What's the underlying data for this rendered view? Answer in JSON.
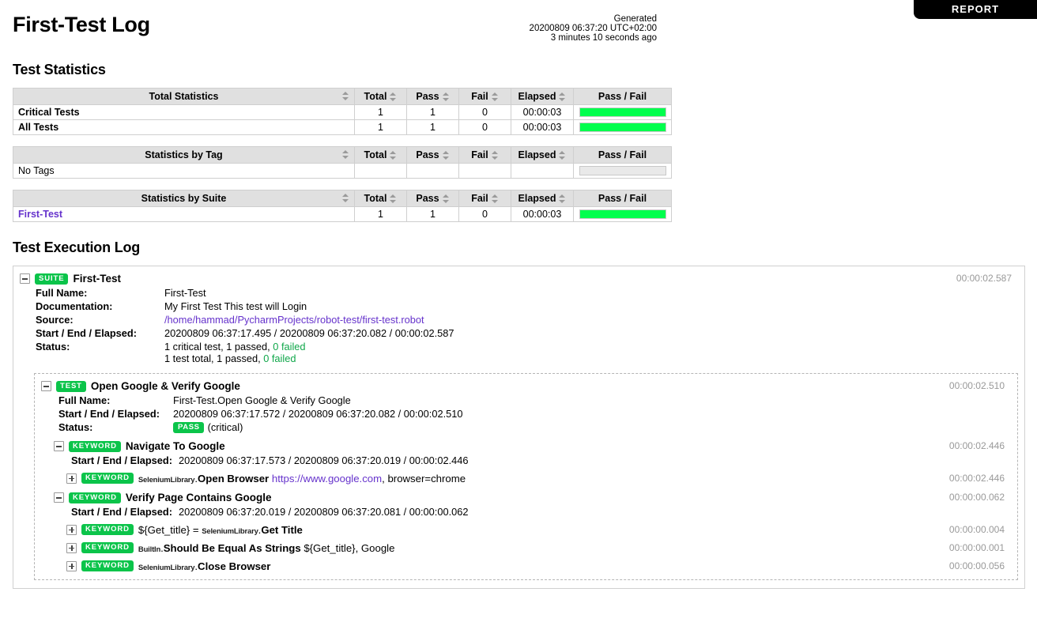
{
  "report_button": {
    "label": "REPORT"
  },
  "header": {
    "title": "First-Test Log",
    "generated_label": "Generated",
    "generated_timestamp": "20200809 06:37:20 UTC+02:00",
    "generated_ago": "3 minutes 10 seconds ago"
  },
  "statistics": {
    "section_title": "Test Statistics",
    "columns": [
      "Total",
      "Pass",
      "Fail",
      "Elapsed",
      "Pass / Fail"
    ],
    "tables": [
      {
        "name_header": "Total Statistics",
        "rows": [
          {
            "name": "Critical Tests",
            "total": "1",
            "pass": "1",
            "fail": "0",
            "elapsed": "00:00:03",
            "pass_pct": 100,
            "is_link": false
          },
          {
            "name": "All Tests",
            "total": "1",
            "pass": "1",
            "fail": "0",
            "elapsed": "00:00:03",
            "pass_pct": 100,
            "is_link": false
          }
        ]
      },
      {
        "name_header": "Statistics by Tag",
        "rows": [
          {
            "name": "No Tags",
            "total": "",
            "pass": "",
            "fail": "",
            "elapsed": "",
            "pass_pct": 0,
            "is_link": false
          }
        ]
      },
      {
        "name_header": "Statistics by Suite",
        "rows": [
          {
            "name": "First-Test",
            "total": "1",
            "pass": "1",
            "fail": "0",
            "elapsed": "00:00:03",
            "pass_pct": 100,
            "is_link": true
          }
        ]
      }
    ]
  },
  "execution_log": {
    "section_title": "Test Execution Log",
    "suite": {
      "badge": "SUITE",
      "name": "First-Test",
      "elapsed": "00:00:02.587",
      "meta": {
        "full_name_key": "Full Name:",
        "full_name_value": "First-Test",
        "documentation_key": "Documentation:",
        "documentation_value": "My First Test This test will Login",
        "source_key": "Source:",
        "source_value": "/home/hammad/PycharmProjects/robot-test/first-test.robot",
        "times_key": "Start / End / Elapsed:",
        "times_value": "20200809 06:37:17.495 / 20200809 06:37:20.082 / 00:00:02.587",
        "status_key": "Status:",
        "status_line1_pre": "1 critical test, 1 passed, ",
        "status_line1_failed": "0 failed",
        "status_line2_pre": "1 test total, 1 passed, ",
        "status_line2_failed": "0 failed"
      }
    },
    "test": {
      "badge": "TEST",
      "name": "Open Google & Verify Google",
      "elapsed": "00:00:02.510",
      "meta": {
        "full_name_key": "Full Name:",
        "full_name_value": "First-Test.Open Google & Verify Google",
        "times_key": "Start / End / Elapsed:",
        "times_value": "20200809 06:37:17.572 / 20200809 06:37:20.082 / 00:00:02.510",
        "status_key": "Status:",
        "status_badge": "PASS",
        "status_suffix": "(critical)"
      }
    },
    "keywords": [
      {
        "badge": "KEYWORD",
        "name": "Navigate To Google",
        "elapsed": "00:00:02.446",
        "times_key": "Start / End / Elapsed:",
        "times_value": "20200809 06:37:17.573 / 20200809 06:37:20.019 / 00:00:02.446",
        "children": [
          {
            "badge": "KEYWORD",
            "assign": "",
            "library": "SeleniumLibrary",
            "kw_name": "Open Browser",
            "args_link": "https://www.google.com",
            "args_rest": ", browser=chrome",
            "elapsed": "00:00:02.446"
          }
        ]
      },
      {
        "badge": "KEYWORD",
        "name": "Verify Page Contains Google",
        "elapsed": "00:00:00.062",
        "times_key": "Start / End / Elapsed:",
        "times_value": "20200809 06:37:20.019 / 20200809 06:37:20.081 / 00:00:00.062",
        "children": [
          {
            "badge": "KEYWORD",
            "assign": "${Get_title} = ",
            "library": "SeleniumLibrary",
            "kw_name": "Get Title",
            "args_link": "",
            "args_rest": "",
            "elapsed": "00:00:00.004"
          },
          {
            "badge": "KEYWORD",
            "assign": "",
            "library": "BuiltIn",
            "kw_name": "Should Be Equal As Strings",
            "args_link": "",
            "args_rest": "${Get_title}, Google",
            "elapsed": "00:00:00.001"
          },
          {
            "badge": "KEYWORD",
            "assign": "",
            "library": "SeleniumLibrary",
            "kw_name": "Close Browser",
            "args_link": "",
            "args_rest": "",
            "elapsed": "00:00:00.056"
          }
        ]
      }
    ]
  },
  "colors": {
    "pass_green": "#00ff4d",
    "badge_green": "#0bc44a",
    "link_purple": "#6633cc",
    "elapsed_gray": "#999999"
  }
}
